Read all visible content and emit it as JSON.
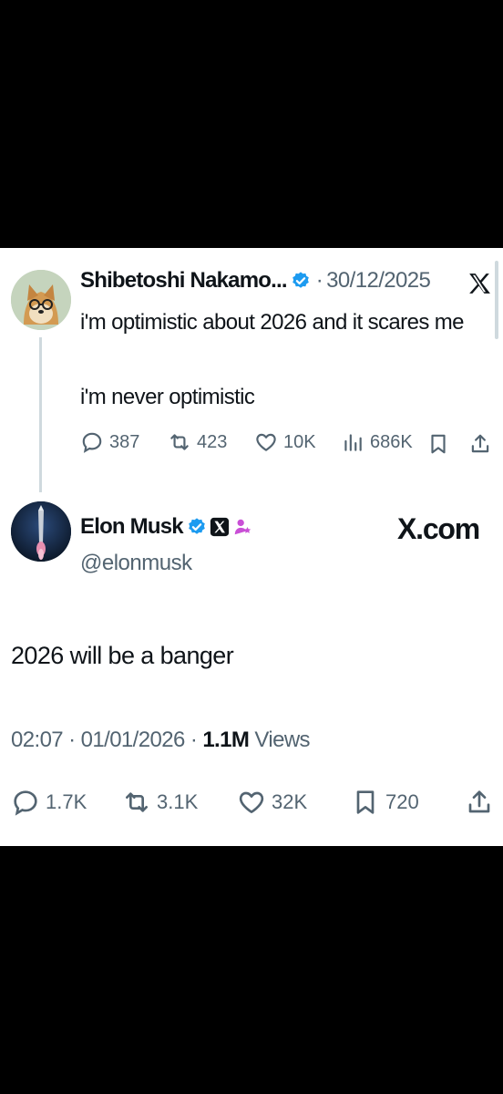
{
  "reply": {
    "display_name": "Shibetoshi Nakamo...",
    "separator": "·",
    "date": "30/12/2025",
    "line1": "i'm optimistic about 2026 and it scares me",
    "line2": "i'm never optimistic",
    "stats": {
      "replies": "387",
      "reposts": "423",
      "likes": "10K",
      "views": "686K"
    }
  },
  "main": {
    "display_name": "Elon Musk",
    "handle": "@elonmusk",
    "brand": "X.com",
    "text": "2026 will be a banger",
    "time": "02:07",
    "sep1": "·",
    "date": "01/01/2026",
    "sep2": "·",
    "views_count": "1.1M",
    "views_label": "Views",
    "stats": {
      "replies": "1.7K",
      "reposts": "3.1K",
      "likes": "32K",
      "bookmarks": "720"
    }
  },
  "colors": {
    "verified": "#1d9bf0",
    "text": "#0f1419",
    "muted": "#536471",
    "affiliate": "#c94fd6"
  },
  "icons": [
    "reply-icon",
    "repost-icon",
    "like-icon",
    "views-icon",
    "bookmark-icon",
    "share-icon",
    "x-logo-icon",
    "verified-badge-icon",
    "affiliate-badge-icon"
  ]
}
